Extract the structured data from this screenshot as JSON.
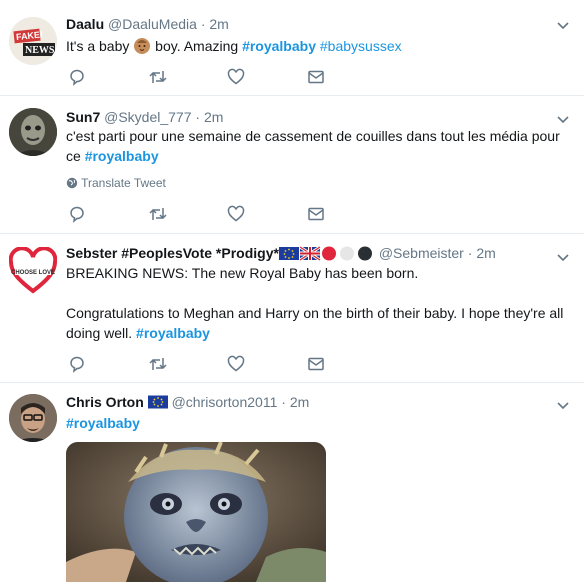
{
  "tweets": [
    {
      "name": "Daalu",
      "handle": "@DaaluMedia",
      "dot": "·",
      "time": "2m",
      "avatar_text": [
        "FAKE!",
        "NEWS"
      ],
      "text_pre": "It's a baby ",
      "text_mid": " boy. Amazing ",
      "hashtags": [
        "#royalbaby",
        "#babysussex"
      ]
    },
    {
      "name": "Sun7",
      "handle": "@Skydel_777",
      "dot": "·",
      "time": "2m",
      "text_pre": "c'est parti pour une semaine de cassement de couilles dans tout les média pour ce ",
      "hashtag": "#royalbaby",
      "translate": "Translate Tweet"
    },
    {
      "name": "Sebster #PeoplesVote *Prodigy*",
      "handle": "@Sebmeister",
      "dot": "·",
      "time": "2m",
      "avatar_text": "CHOOSE LOVE",
      "line1": "BREAKING NEWS: The new Royal Baby has been born.",
      "line2": "Congratulations to Meghan and Harry on the birth of their baby. I hope they're all doing well. ",
      "hashtag": "#royalbaby"
    },
    {
      "name": "Chris Orton",
      "handle": "@chrisorton2011",
      "dot": "·",
      "time": "2m",
      "hashtag": "#royalbaby"
    }
  ],
  "icons": {
    "reply": "reply-icon",
    "retweet": "retweet-icon",
    "like": "like-icon",
    "dm": "direct-message-icon",
    "caret": "chevron-down-icon",
    "globe": "globe-icon"
  },
  "colors": {
    "hashtag": "#1b95e0",
    "secondary": "#657786",
    "divider": "#e6ecf0"
  }
}
